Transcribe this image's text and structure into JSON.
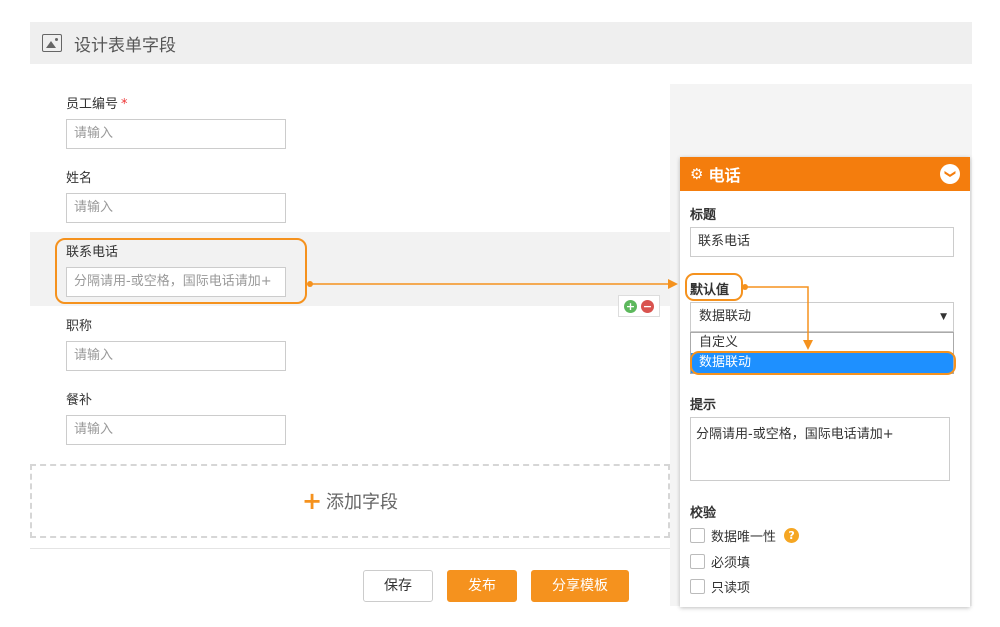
{
  "header": {
    "title": "设计表单字段",
    "icon": "image-icon"
  },
  "form": {
    "fields": [
      {
        "label": "员工编号",
        "required": "*",
        "placeholder": "请输入"
      },
      {
        "label": "姓名",
        "placeholder": "请输入"
      },
      {
        "label": "联系电话",
        "placeholder": "分隔请用-或空格，国际电话请加+"
      },
      {
        "label": "职称",
        "placeholder": "请输入"
      },
      {
        "label": "餐补",
        "placeholder": "请输入"
      }
    ],
    "add_field": {
      "plus": "+",
      "label": "添加字段"
    }
  },
  "mini_controls": {
    "add": "+",
    "remove": "−"
  },
  "buttons": {
    "save": "保存",
    "publish": "发布",
    "share": "分享模板"
  },
  "panel": {
    "title": "电话",
    "gear": "⚙",
    "collapse": "❯",
    "title_label": "标题",
    "title_value": "联系电话",
    "default_label": "默认值",
    "default_value": "数据联动",
    "default_options": [
      "自定义",
      "数据联动"
    ],
    "hint_label": "提示",
    "hint_value": "分隔请用-或空格，国际电话请加+",
    "validate_label": "校验",
    "checks": [
      "数据唯一性",
      "必须填",
      "只读项"
    ],
    "help": "?"
  },
  "colors": {
    "accent": "#f47d0d",
    "highlight": "#f5921e",
    "selected": "#1e90ff"
  }
}
